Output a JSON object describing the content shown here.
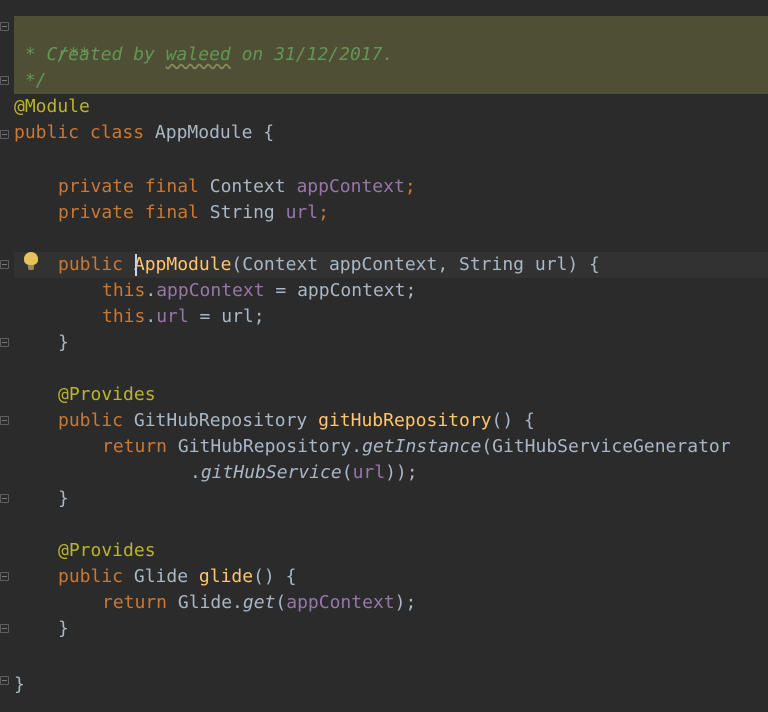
{
  "editor": {
    "comment": {
      "open": "/**",
      "prefix": " * Created by ",
      "author": "waleed",
      "suffix": " on 31/12/2017.",
      "close": " */"
    },
    "annotation_module": "@Module",
    "class_decl": {
      "kw": "public class",
      "name": "AppModule",
      "brace": " {"
    },
    "fields": [
      {
        "mods": "private final",
        "type": " Context ",
        "name": "appContext",
        "end": ";"
      },
      {
        "mods": "private final",
        "type": " String ",
        "name": "url",
        "end": ";"
      }
    ],
    "constructor": {
      "kw": "public",
      "name": "AppModule",
      "params": "(Context appContext, String url) {",
      "body": [
        {
          "this": "this",
          "field": "appContext",
          "rest": " = appContext;"
        },
        {
          "this": "this",
          "field": "url",
          "rest": " = url;"
        }
      ],
      "close": "}"
    },
    "provider1": {
      "annotation": "@Provides",
      "kw": "public",
      "type": " GitHubRepository ",
      "name": "gitHubRepository",
      "sig_end": "() {",
      "ret_kw": "return",
      "ret_obj": " GitHubRepository.",
      "ret_call": "getInstance",
      "ret_arg": "(GitHubServiceGenerator",
      "cont_dot": ".",
      "cont_call": "gitHubService",
      "cont_open": "(",
      "cont_field": "url",
      "cont_end": "));",
      "close": "}"
    },
    "provider2": {
      "annotation": "@Provides",
      "kw": "public",
      "type": " Glide ",
      "name": "glide",
      "sig_end": "() {",
      "ret_kw": "return",
      "ret_obj": " Glide.",
      "ret_call": "get",
      "ret_open": "(",
      "ret_field": "appContext",
      "ret_end": ");",
      "close": "}"
    },
    "class_close": "}",
    "icons": {
      "intention": "lightbulb-icon",
      "fold": "fold-marker-icon"
    }
  }
}
